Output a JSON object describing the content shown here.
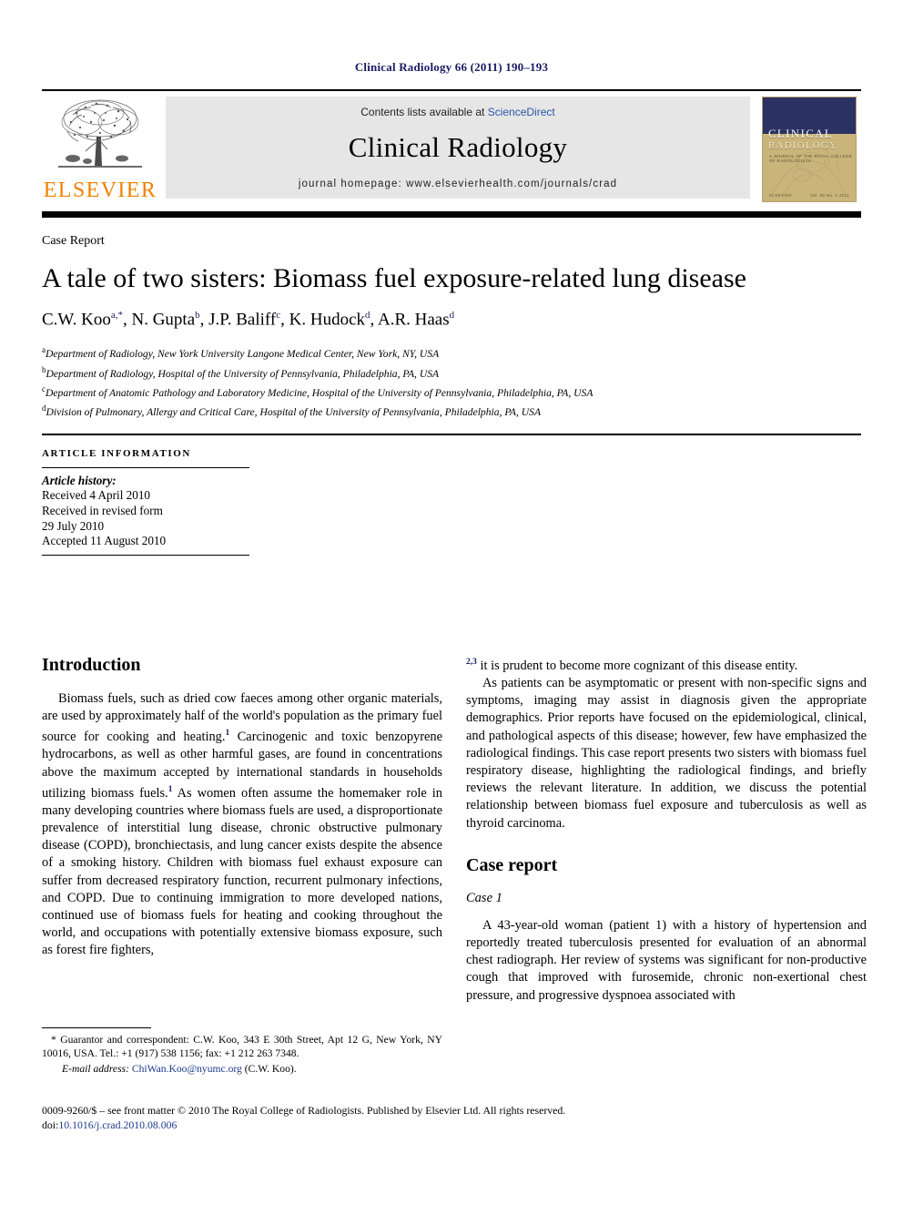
{
  "running_head": "Clinical Radiology 66 (2011) 190–193",
  "masthead": {
    "publisher_logo_label": "ELSEVIER",
    "contents_prefix": "Contents lists available at",
    "contents_link": "ScienceDirect",
    "journal_name": "Clinical Radiology",
    "homepage_line": "journal homepage: www.elsevierhealth.com/journals/crad",
    "cover": {
      "line1": "CLINICAL",
      "line2": "RADIOLOGY",
      "subtitle": "A JOURNAL OF THE ROYAL COLLEGE OF RADIOLOGISTS",
      "foot_left": "ELSEVIER",
      "foot_right": "Vol. 66 No. 2 2011"
    }
  },
  "article": {
    "kicker": "Case Report",
    "title": "A tale of two sisters: Biomass fuel exposure-related lung disease",
    "authors": [
      {
        "name": "C.W. Koo",
        "sup": "a,*"
      },
      {
        "name": "N. Gupta",
        "sup": "b"
      },
      {
        "name": "J.P. Baliff",
        "sup": "c"
      },
      {
        "name": "K. Hudock",
        "sup": "d"
      },
      {
        "name": "A.R. Haas",
        "sup": "d"
      }
    ],
    "authors_line": "C.W. Koo a,*, N. Gupta b, J.P. Baliff c, K. Hudock d, A.R. Haas d",
    "affiliations": [
      {
        "marker": "a",
        "text": "Department of Radiology, New York University Langone Medical Center, New York, NY, USA"
      },
      {
        "marker": "b",
        "text": "Department of Radiology, Hospital of the University of Pennsylvania, Philadelphia, PA, USA"
      },
      {
        "marker": "c",
        "text": "Department of Anatomic Pathology and Laboratory Medicine, Hospital of the University of Pennsylvania, Philadelphia, PA, USA"
      },
      {
        "marker": "d",
        "text": "Division of Pulmonary, Allergy and Critical Care, Hospital of the University of Pennsylvania, Philadelphia, PA, USA"
      }
    ]
  },
  "article_info": {
    "heading": "ARTICLE INFORMATION",
    "history_label": "Article history:",
    "received": "Received 4 April 2010",
    "revised_label": "Received in revised form",
    "revised_date": "29 July 2010",
    "accepted": "Accepted 11 August 2010"
  },
  "sections": {
    "introduction_heading": "Introduction",
    "intro_p1_a": "Biomass fuels, such as dried cow faeces among other organic materials, are used by approximately half of the world's population as the primary fuel source for cooking and heating.",
    "intro_p1_sup1": "1",
    "intro_p1_b": " Carcinogenic and toxic benzopyrene hydrocarbons, as well as other harmful gases, are found in concentrations above the maximum accepted by international standards in households utilizing biomass fuels.",
    "intro_p1_sup2": "1",
    "intro_p1_c": " As women often assume the homemaker role in many developing countries where biomass fuels are used, a disproportionate prevalence of interstitial lung disease, chronic obstructive pulmonary disease (COPD), bronchiectasis, and lung cancer exists despite the absence of a smoking history. Children with biomass fuel exhaust exposure can suffer from decreased respiratory function, recurrent pulmonary infections, and COPD. Due to continuing immigration to more developed nations, continued use of biomass fuels for heating and cooking throughout the world, and occupations with potentially extensive biomass exposure, such as forest fire fighters,",
    "intro_p1_sup3": "2,3",
    "intro_p1_d": " it is prudent to become more cognizant of this disease entity.",
    "intro_p2": "As patients can be asymptomatic or present with non-specific signs and symptoms, imaging may assist in diagnosis given the appropriate demographics. Prior reports have focused on the epidemiological, clinical, and pathological aspects of this disease; however, few have emphasized the radiological findings. This case report presents two sisters with biomass fuel respiratory disease, highlighting the radiological findings, and briefly reviews the relevant literature. In addition, we discuss the potential relationship between biomass fuel exposure and tuberculosis as well as thyroid carcinoma.",
    "case_report_heading": "Case report",
    "case1_heading": "Case 1",
    "case1_p1": "A 43-year-old woman (patient 1) with a history of hypertension and reportedly treated tuberculosis presented for evaluation of an abnormal chest radiograph. Her review of systems was significant for non-productive cough that improved with furosemide, chronic non-exertional chest pressure, and progressive dyspnoea associated with"
  },
  "footnote": {
    "star": "*",
    "correspondence": " Guarantor and correspondent: C.W. Koo, 343 E 30th Street, Apt 12 G, New York, NY 10016, USA. Tel.: +1 (917) 538 1156; fax: +1 212 263 7348.",
    "email_label": "E-mail address:",
    "email": "ChiWan.Koo@nyumc.org",
    "email_owner": "(C.W. Koo)."
  },
  "copyright": {
    "line1": "0009-9260/$ – see front matter © 2010 The Royal College of Radiologists. Published by Elsevier Ltd. All rights reserved.",
    "doi_label": "doi:",
    "doi_value": "10.1016/j.crad.2010.08.006"
  },
  "colors": {
    "running_head": "#1b1b63",
    "elsevier_orange": "#ef8200",
    "link_blue": "#2b57a8",
    "cover_navy": "#2c3163",
    "cover_tan": "#c9b47a",
    "masthead_grey": "#e6e6e6"
  }
}
